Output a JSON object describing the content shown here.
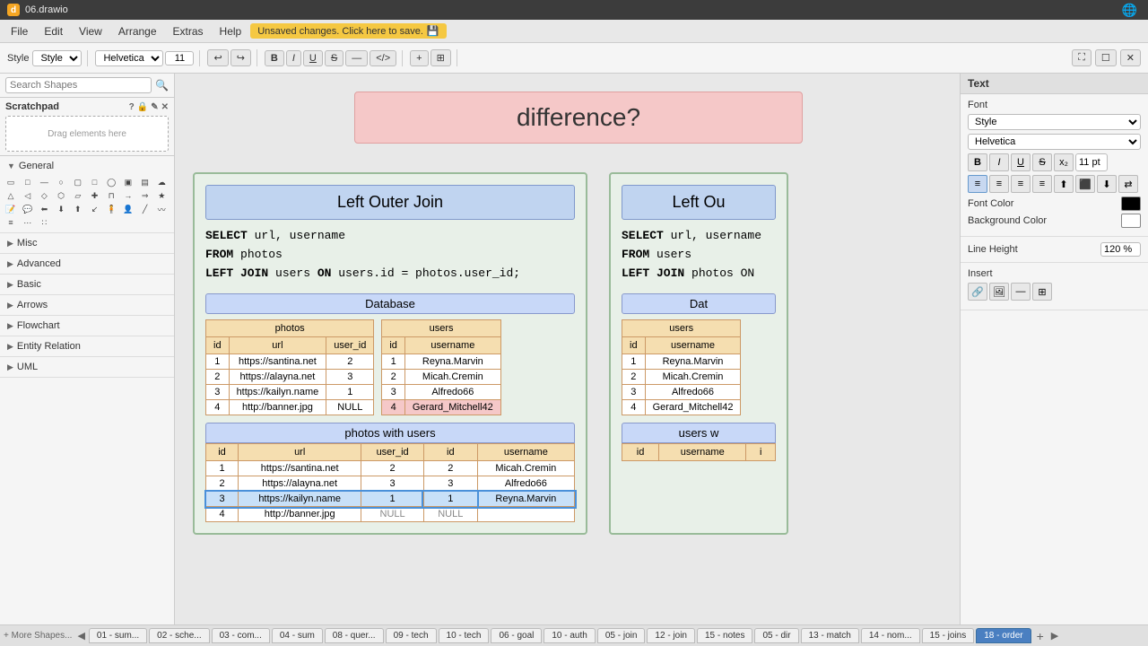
{
  "titlebar": {
    "filename": "06.drawio"
  },
  "menubar": {
    "items": [
      "File",
      "Edit",
      "View",
      "Arrange",
      "Extras",
      "Help"
    ],
    "unsaved_btn": "Unsaved changes. Click here to save."
  },
  "toolbar": {
    "style_label": "Style",
    "font_name": "Helvetica",
    "font_size": "11",
    "undo_icon": "↩",
    "redo_icon": "↪",
    "bold_label": "B",
    "italic_label": "I",
    "underline_label": "U",
    "strikethrough_label": "S",
    "code_label": "</>",
    "plus_label": "+",
    "table_label": "⊞",
    "fullscreen_icon": "⛶",
    "page_icon": "☐",
    "close_icon": "✕"
  },
  "sidebar": {
    "search_placeholder": "Search Shapes",
    "scratchpad_label": "Scratchpad",
    "scratchpad_drag_text": "Drag elements here",
    "sections": [
      {
        "label": "General",
        "expanded": true
      },
      {
        "label": "Misc",
        "expanded": false
      },
      {
        "label": "Advanced",
        "expanded": false
      },
      {
        "label": "Basic",
        "expanded": false
      },
      {
        "label": "Arrows",
        "expanded": false
      },
      {
        "label": "Flowchart",
        "expanded": false
      },
      {
        "label": "Entity Relation",
        "expanded": false
      },
      {
        "label": "UML",
        "expanded": false
      }
    ]
  },
  "right_panel": {
    "title": "Text",
    "font_section": "Font",
    "font_style_placeholder": "Style",
    "font_name": "Helvetica",
    "font_size": "11 pt",
    "format_buttons": [
      "B",
      "I",
      "U",
      "S",
      "⟨",
      "≡",
      "≡",
      "≡",
      "≡",
      "≡"
    ],
    "font_color_label": "Font Color",
    "bg_color_label": "Background Color",
    "line_height_label": "Line Height",
    "line_height_value": "120 %"
  },
  "diagram": {
    "title": "difference?",
    "left_join": {
      "title": "Left Outer Join",
      "code_line1": "SELECT url, username",
      "code_line2": "FROM photos",
      "code_line3": "LEFT JOIN users ON users.id = photos.user_id;",
      "db_title": "Database",
      "photos_table": {
        "title": "photos",
        "headers": [
          "id",
          "url",
          "user_id"
        ],
        "rows": [
          [
            "1",
            "https://santina.net",
            "2"
          ],
          [
            "2",
            "https://alayna.net",
            "3"
          ],
          [
            "3",
            "https://kailyn.name",
            "1"
          ],
          [
            "4",
            "http://banner.jpg",
            "NULL"
          ]
        ]
      },
      "users_table": {
        "title": "users",
        "headers": [
          "id",
          "username"
        ],
        "rows": [
          [
            "1",
            "Reyna.Marvin"
          ],
          [
            "2",
            "Micah.Cremin"
          ],
          [
            "3",
            "Alfredo66"
          ],
          [
            "4",
            "Gerard_Mitchell42"
          ]
        ],
        "highlighted_row": 3
      },
      "result_table": {
        "title": "photos with users",
        "headers": [
          "id",
          "url",
          "user_id",
          "id",
          "username"
        ],
        "rows": [
          [
            "1",
            "https://santina.net",
            "2",
            "2",
            "Micah.Cremin",
            false
          ],
          [
            "2",
            "https://alayna.net",
            "3",
            "3",
            "Alfredo66",
            false
          ],
          [
            "3",
            "https://kailyn.name",
            "1",
            "1",
            "Reyna.Marvin",
            true
          ],
          [
            "4",
            "http://banner.jpg",
            "NULL",
            "NULL",
            "",
            false
          ]
        ]
      }
    },
    "right_join": {
      "title": "Left Ou",
      "code_line1": "SELECT url, username",
      "code_line2": "FROM users",
      "code_line3": "LEFT JOIN photos ON",
      "db_title": "Dat",
      "users_table": {
        "title": "users",
        "headers": [
          "id",
          "username"
        ],
        "rows": [
          [
            "1",
            "Reyna.Marvin"
          ],
          [
            "2",
            "Micah.Cremin"
          ],
          [
            "3",
            "Alfredo66"
          ],
          [
            "4",
            "Gerard_Mitchell42"
          ]
        ]
      },
      "result_table": {
        "title": "users w",
        "headers": [
          "id",
          "username",
          "i"
        ]
      }
    }
  },
  "tabs": [
    {
      "label": "01 - sum...",
      "active": false
    },
    {
      "label": "02 - sche...",
      "active": false
    },
    {
      "label": "03 - com...",
      "active": false
    },
    {
      "label": "04 - sum",
      "active": false
    },
    {
      "label": "08 - quer...",
      "active": false
    },
    {
      "label": "09 - tech",
      "active": false
    },
    {
      "label": "10 - tech",
      "active": false
    },
    {
      "label": "06 - goal",
      "active": false
    },
    {
      "label": "10 - auth",
      "active": false
    },
    {
      "label": "05 - join",
      "active": false
    },
    {
      "label": "12 - join",
      "active": false
    },
    {
      "label": "15 - notes",
      "active": false
    },
    {
      "label": "05 - dir",
      "active": false
    },
    {
      "label": "13 - match",
      "active": false
    },
    {
      "label": "14 - nom...",
      "active": false
    },
    {
      "label": "15 - joins",
      "active": false
    },
    {
      "label": "18 - order",
      "active": true
    }
  ],
  "statusbar": {
    "more_shapes": "+ More Shapes...",
    "page_indicator": "◀  ▶"
  }
}
